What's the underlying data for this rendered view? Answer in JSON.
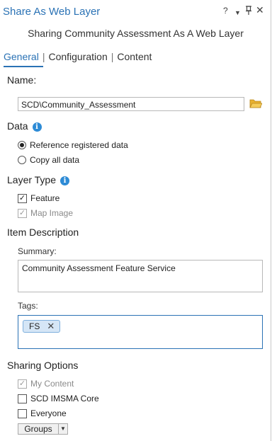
{
  "pane": {
    "title": "Share As Web Layer",
    "controls": {
      "help": "?",
      "menu": "▼",
      "pin": "ᵠ",
      "close": "✕"
    }
  },
  "subtitle": "Sharing Community Assessment As A Web Layer",
  "tabs": [
    {
      "label": "General",
      "active": true
    },
    {
      "label": "Configuration",
      "active": false
    },
    {
      "label": "Content",
      "active": false
    }
  ],
  "tab_separator": "|",
  "name": {
    "heading": "Name:",
    "value": "SCD\\Community_Assessment",
    "browse_icon": "folder-icon"
  },
  "data_section": {
    "heading": "Data",
    "info_icon": "i",
    "options": [
      {
        "label": "Reference registered data",
        "selected": true
      },
      {
        "label": "Copy all data",
        "selected": false
      }
    ]
  },
  "layer_type": {
    "heading": "Layer Type",
    "info_icon": "i",
    "options": [
      {
        "label": "Feature",
        "checked": true,
        "enabled": true
      },
      {
        "label": "Map Image",
        "checked": true,
        "enabled": false
      }
    ]
  },
  "item_description": {
    "heading": "Item Description",
    "summary_label": "Summary:",
    "summary_value": "Community Assessment Feature Service",
    "tags_label": "Tags:",
    "tags": [
      "FS"
    ],
    "tag_remove": "✕"
  },
  "sharing_options": {
    "heading": "Sharing Options",
    "options": [
      {
        "label": "My Content",
        "checked": true,
        "enabled": false
      },
      {
        "label": "SCD IMSMA Core",
        "checked": false,
        "enabled": true
      },
      {
        "label": "Everyone",
        "checked": false,
        "enabled": true
      }
    ],
    "groups_button": "Groups",
    "groups_arrow": "▼"
  },
  "colors": {
    "accent": "#2a72b5",
    "info": "#2d8bd6",
    "folder": "#e8b130"
  },
  "check_glyph": "✓"
}
